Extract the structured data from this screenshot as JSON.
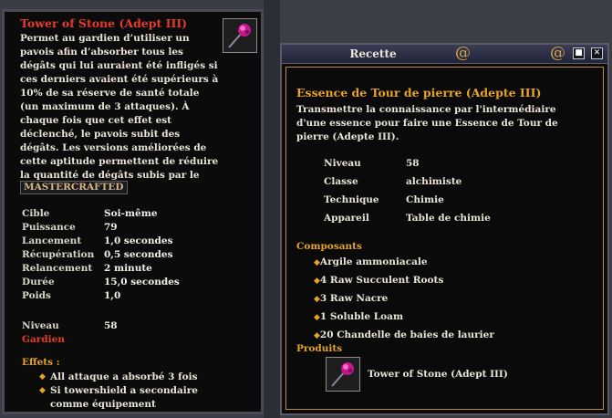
{
  "tooltip": {
    "title": "Tower of Stone (Adept III)",
    "description": "Permet au gardien d’utiliser un pavois afin d’absorber tous les dégâts qui lui auraient été infligés si ces derniers avaient été supérieurs à 10% de sa réserve de santé totale (un maximum de 3 attaques). À chaque fois que cet effet est déclenché, le pavois subit des dégâts. Les versions améliorées de cette aptitude permettent de réduire la quantité de dégâts subis par le pavois.",
    "icon": "shield-spell-icon",
    "badge": "MASTERCRAFTED",
    "stats": [
      {
        "label": "Cible",
        "value": "Soi-même"
      },
      {
        "label": "Puissance",
        "value": "79"
      },
      {
        "label": "Lancement",
        "value": "1,0 secondes"
      },
      {
        "label": "Récupération",
        "value": "0,5 secondes"
      },
      {
        "label": "Relancement",
        "value": "2 minute"
      },
      {
        "label": "Durée",
        "value": "15,0 secondes"
      },
      {
        "label": "Poids",
        "value": "1,0"
      }
    ],
    "level_label": "Niveau",
    "level_value": "58",
    "class_name": "Gardien",
    "effects_heading": "Effets :",
    "effects": [
      "All attaque a absorbé 3 fois",
      "Si towershield a secondaire comme équipement"
    ]
  },
  "recipe_window": {
    "title": "Recette",
    "pin_icon": "pin-icon",
    "close_icon": "close-icon",
    "name": "Essence de Tour de pierre (Adepte III)",
    "description": "Transmettre la connaissance par l'intermédiaire d'une essence pour faire une Essence de Tour de pierre (Adepte III).",
    "details": [
      {
        "label": "Niveau",
        "value": "58"
      },
      {
        "label": "Classe",
        "value": "alchimiste"
      },
      {
        "label": "Technique",
        "value": "Chimie"
      },
      {
        "label": "Appareil",
        "value": "Table de chimie"
      }
    ],
    "components_heading": "Composants",
    "components": [
      "Argile ammoniacale",
      "4 Raw Succulent Roots",
      "3 Raw Nacre",
      "1 Soluble Loam",
      "20 Chandelle de baies de laurier"
    ],
    "products_heading": "Produits",
    "product_name": "Tower of Stone (Adept III)",
    "product_icon": "shield-spell-icon"
  },
  "colors": {
    "title_red": "#e63a2c",
    "heading_gold": "#e6a326",
    "panel_bg": "#0b0b0b"
  }
}
